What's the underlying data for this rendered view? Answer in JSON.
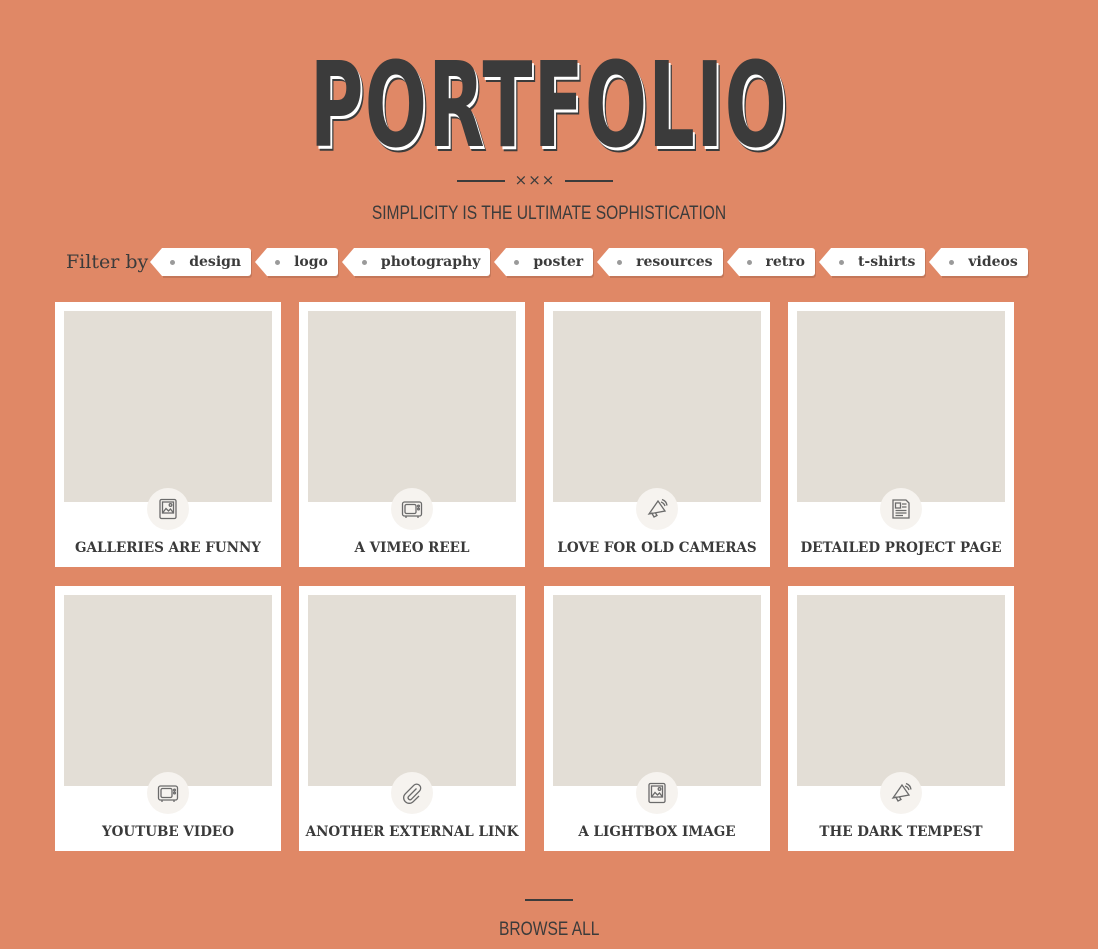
{
  "header": {
    "title": "PORTFOLIO",
    "divider_marks": "×××",
    "tagline": "SIMPLICITY IS THE ULTIMATE SOPHISTICATION"
  },
  "filter": {
    "label": "Filter by",
    "tags": [
      "design",
      "logo",
      "photography",
      "poster",
      "resources",
      "retro",
      "t-shirts",
      "videos"
    ]
  },
  "items": [
    {
      "title": "GALLERIES ARE FUNNY",
      "icon": "image-icon"
    },
    {
      "title": "A VIMEO REEL",
      "icon": "tv-icon"
    },
    {
      "title": "LOVE FOR OLD CAMERAS",
      "icon": "megaphone-icon"
    },
    {
      "title": "DETAILED PROJECT PAGE",
      "icon": "document-icon"
    },
    {
      "title": "YOUTUBE VIDEO",
      "icon": "tv-icon"
    },
    {
      "title": "ANOTHER EXTERNAL LINK",
      "icon": "paperclip-icon"
    },
    {
      "title": "A LIGHTBOX IMAGE",
      "icon": "image-icon"
    },
    {
      "title": "THE DARK TEMPEST",
      "icon": "megaphone-icon"
    }
  ],
  "footer": {
    "browse_label": "BROWSE ALL"
  },
  "colors": {
    "background": "#e08866",
    "text": "#3b3b3b",
    "card": "#ffffff",
    "thumb": "#e3ded6"
  }
}
